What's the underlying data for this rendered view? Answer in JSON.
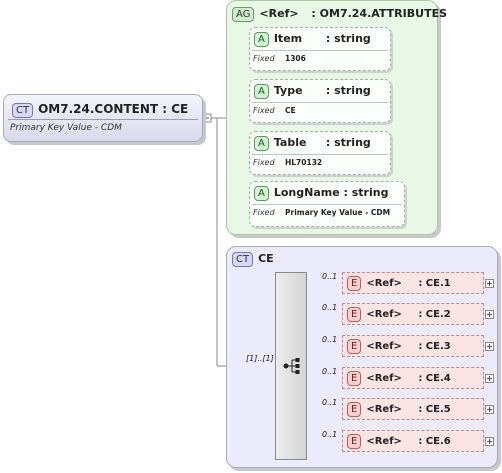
{
  "root": {
    "badge": "CT",
    "title": "OM7.24.CONTENT : CE",
    "subtitle": "Primary Key Value - CDM"
  },
  "attribute_group": {
    "badge": "AG",
    "ref": "<Ref>",
    "name": ": OM7.24.ATTRIBUTES",
    "attributes": [
      {
        "badge": "A",
        "name": "Item",
        "type": ": string",
        "fixed_label": "Fixed",
        "fixed_value": "1306"
      },
      {
        "badge": "A",
        "name": "Type",
        "type": ": string",
        "fixed_label": "Fixed",
        "fixed_value": "CE"
      },
      {
        "badge": "A",
        "name": "Table",
        "type": ": string",
        "fixed_label": "Fixed",
        "fixed_value": "HL70132"
      },
      {
        "badge": "A",
        "name": "LongName",
        "type": ": string",
        "fixed_label": "Fixed",
        "fixed_value": "Primary Key Value - CDM"
      }
    ]
  },
  "complex_type": {
    "badge": "CT",
    "name": "CE",
    "sequence_occurrence": "[1]..[1]",
    "elements": [
      {
        "badge": "E",
        "ref": "<Ref>",
        "name": ": CE.1",
        "occurrence": "0..1"
      },
      {
        "badge": "E",
        "ref": "<Ref>",
        "name": ": CE.2",
        "occurrence": "0..1"
      },
      {
        "badge": "E",
        "ref": "<Ref>",
        "name": ": CE.3",
        "occurrence": "0..1"
      },
      {
        "badge": "E",
        "ref": "<Ref>",
        "name": ": CE.4",
        "occurrence": "0..1"
      },
      {
        "badge": "E",
        "ref": "<Ref>",
        "name": ": CE.5",
        "occurrence": "0..1"
      },
      {
        "badge": "E",
        "ref": "<Ref>",
        "name": ": CE.6",
        "occurrence": "0..1"
      }
    ],
    "expand_glyph": "+"
  },
  "colors": {
    "attribute_group_bg": "#e9f8e6",
    "complex_type_bg": "#ebebfb",
    "element_bg": "#fbe4e4"
  }
}
